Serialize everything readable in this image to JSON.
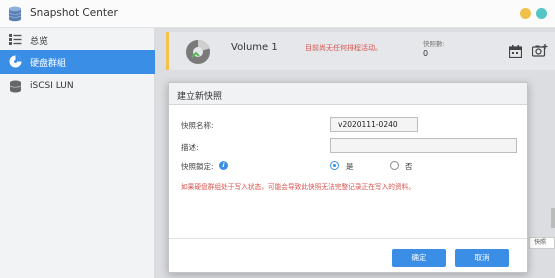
{
  "app": {
    "title": "Snapshot Center",
    "icon": "database-icon"
  },
  "window_buttons": {
    "minimize_color": "#f0c04c",
    "maximize_color": "#53c6c5"
  },
  "sidebar": {
    "items": [
      {
        "label": "总览",
        "icon": "overview-list-icon",
        "active": false
      },
      {
        "label": "硬盘群組",
        "icon": "disk-pie-icon",
        "active": true
      },
      {
        "label": "iSCSI LUN",
        "icon": "database-icon",
        "active": false
      }
    ]
  },
  "volume": {
    "name": "Volume 1",
    "status": "目前尚无任何排程活动。",
    "count_label": "快照數:",
    "count": "0",
    "accent": "#f2c14e"
  },
  "right_tab": {
    "label": "快照"
  },
  "dialog": {
    "title": "建立新快照",
    "name_label": "快照名称:",
    "name_value": "v2020111-0240",
    "desc_label": "描述:",
    "desc_value": "",
    "lock_label": "快照鎖定:",
    "lock_options": {
      "yes": "是",
      "no": "否"
    },
    "lock_selected": "yes",
    "warning": "如果硬盘群组处于写入状态，可能会导致此快照无法完整记录正在写入的资料。",
    "ok_label": "确定",
    "cancel_label": "取消"
  },
  "colors": {
    "accent": "#3a8ee6",
    "warning": "#d9534f"
  }
}
